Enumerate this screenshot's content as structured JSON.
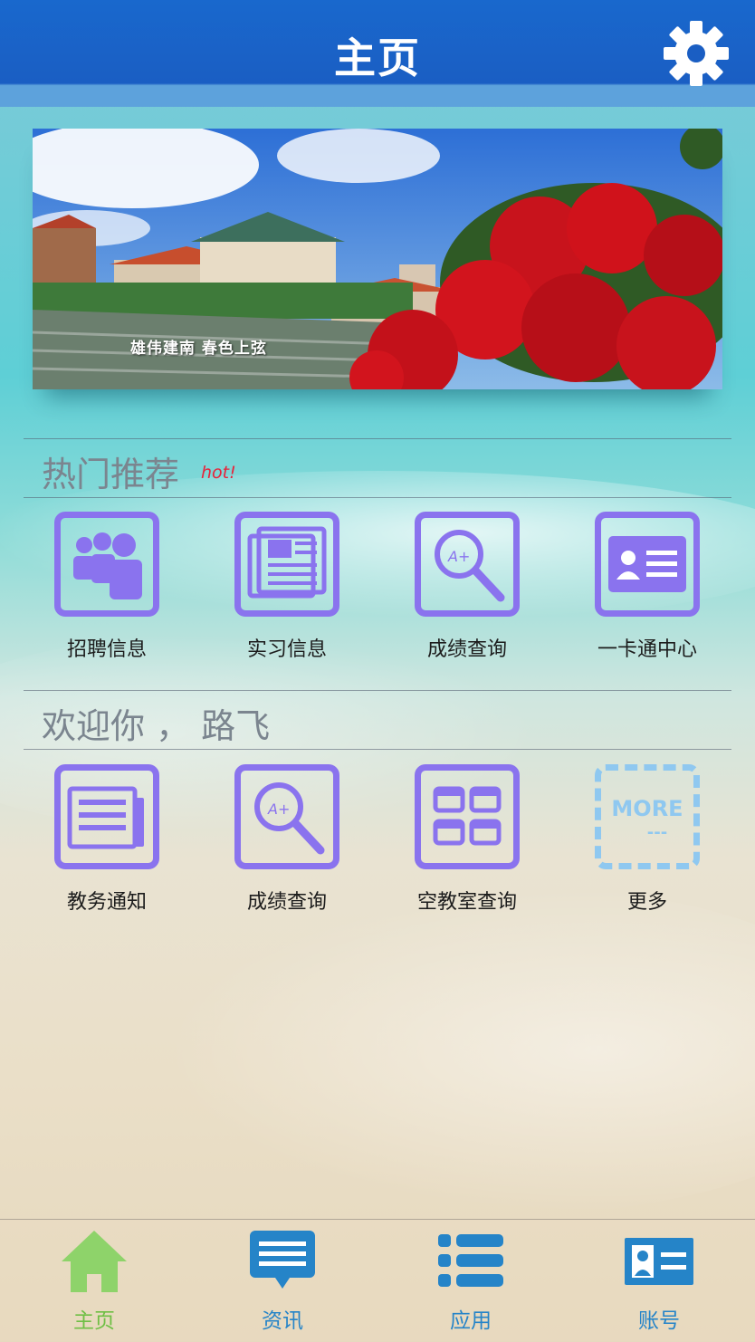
{
  "header": {
    "title": "主页",
    "settings_icon": "gear-icon"
  },
  "banner": {
    "caption": "雄伟建南  春色上弦"
  },
  "hot_section": {
    "title": "热门推荐",
    "badge": "hot!",
    "items": [
      {
        "label": "招聘信息",
        "icon": "people-group-icon"
      },
      {
        "label": "实习信息",
        "icon": "newspaper-icon"
      },
      {
        "label": "成绩查询",
        "icon": "grade-search-icon"
      },
      {
        "label": "一卡通中心",
        "icon": "id-card-icon"
      }
    ]
  },
  "welcome_section": {
    "title": "欢迎你 ， 路飞",
    "items": [
      {
        "label": "教务通知",
        "icon": "notice-icon"
      },
      {
        "label": "成绩查询",
        "icon": "grade-search-icon"
      },
      {
        "label": "空教室查询",
        "icon": "classroom-grid-icon"
      },
      {
        "label": "更多",
        "icon": "more-icon",
        "more_text": "MORE",
        "more_dots": "---"
      }
    ]
  },
  "tabbar": {
    "tabs": [
      {
        "label": "主页",
        "icon": "home-icon",
        "active": true
      },
      {
        "label": "资讯",
        "icon": "message-icon",
        "active": false
      },
      {
        "label": "应用",
        "icon": "list-icon",
        "active": false
      },
      {
        "label": "账号",
        "icon": "account-card-icon",
        "active": false
      }
    ]
  },
  "colors": {
    "header_blue": "#1a5ec3",
    "tile_purple": "#8a73ee",
    "more_blue": "#8fc8f0",
    "tab_blue": "#2584c8",
    "tab_active_green": "#6fbf45",
    "hot_red": "#e8233a"
  }
}
